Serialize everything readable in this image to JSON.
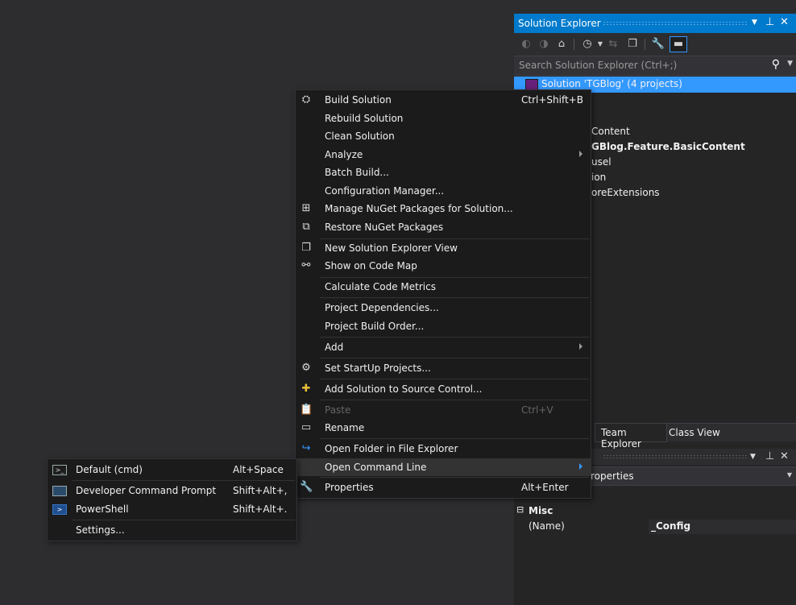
{
  "solution_explorer": {
    "title": "Solution Explorer",
    "search_placeholder": "Search Solution Explorer (Ctrl+;)",
    "tree": {
      "solution": "Solution 'TGBlog' (4 projects)",
      "partial_items": [
        "Content",
        "GBlog.Feature.BasicContent",
        "usel",
        "ion",
        "oreExtensions"
      ]
    },
    "bottom_tabs": [
      "Team Explorer",
      "Class View"
    ]
  },
  "properties": {
    "combo_text": "roperties",
    "category": "Misc",
    "rows": [
      {
        "name": "(Name)",
        "value": "_Config"
      }
    ]
  },
  "context_menu": {
    "items": [
      {
        "label": "Build Solution",
        "shortcut": "Ctrl+Shift+B"
      },
      {
        "label": "Rebuild Solution"
      },
      {
        "label": "Clean Solution"
      },
      {
        "label": "Analyze"
      },
      {
        "label": "Batch Build..."
      },
      {
        "label": "Configuration Manager..."
      },
      {
        "label": "Manage NuGet Packages for Solution..."
      },
      {
        "label": "Restore NuGet Packages"
      },
      {
        "label": "New Solution Explorer View"
      },
      {
        "label": "Show on Code Map"
      },
      {
        "label": "Calculate Code Metrics"
      },
      {
        "label": "Project Dependencies..."
      },
      {
        "label": "Project Build Order..."
      },
      {
        "label": "Add"
      },
      {
        "label": "Set StartUp Projects..."
      },
      {
        "label": "Add Solution to Source Control..."
      },
      {
        "label": "Paste",
        "shortcut": "Ctrl+V"
      },
      {
        "label": "Rename"
      },
      {
        "label": "Open Folder in File Explorer"
      },
      {
        "label": "Open Command Line"
      },
      {
        "label": "Properties",
        "shortcut": "Alt+Enter"
      }
    ]
  },
  "submenu": {
    "items": [
      {
        "label": "Default (cmd)",
        "shortcut": "Alt+Space"
      },
      {
        "label": "Developer Command Prompt",
        "shortcut": "Shift+Alt+,"
      },
      {
        "label": "PowerShell",
        "shortcut": "Shift+Alt+."
      },
      {
        "label": "Settings..."
      }
    ]
  },
  "colors": {
    "accent": "#007acc",
    "selection": "#3399ff",
    "menu_bg": "#1b1b1c",
    "background": "#2d2d30"
  }
}
